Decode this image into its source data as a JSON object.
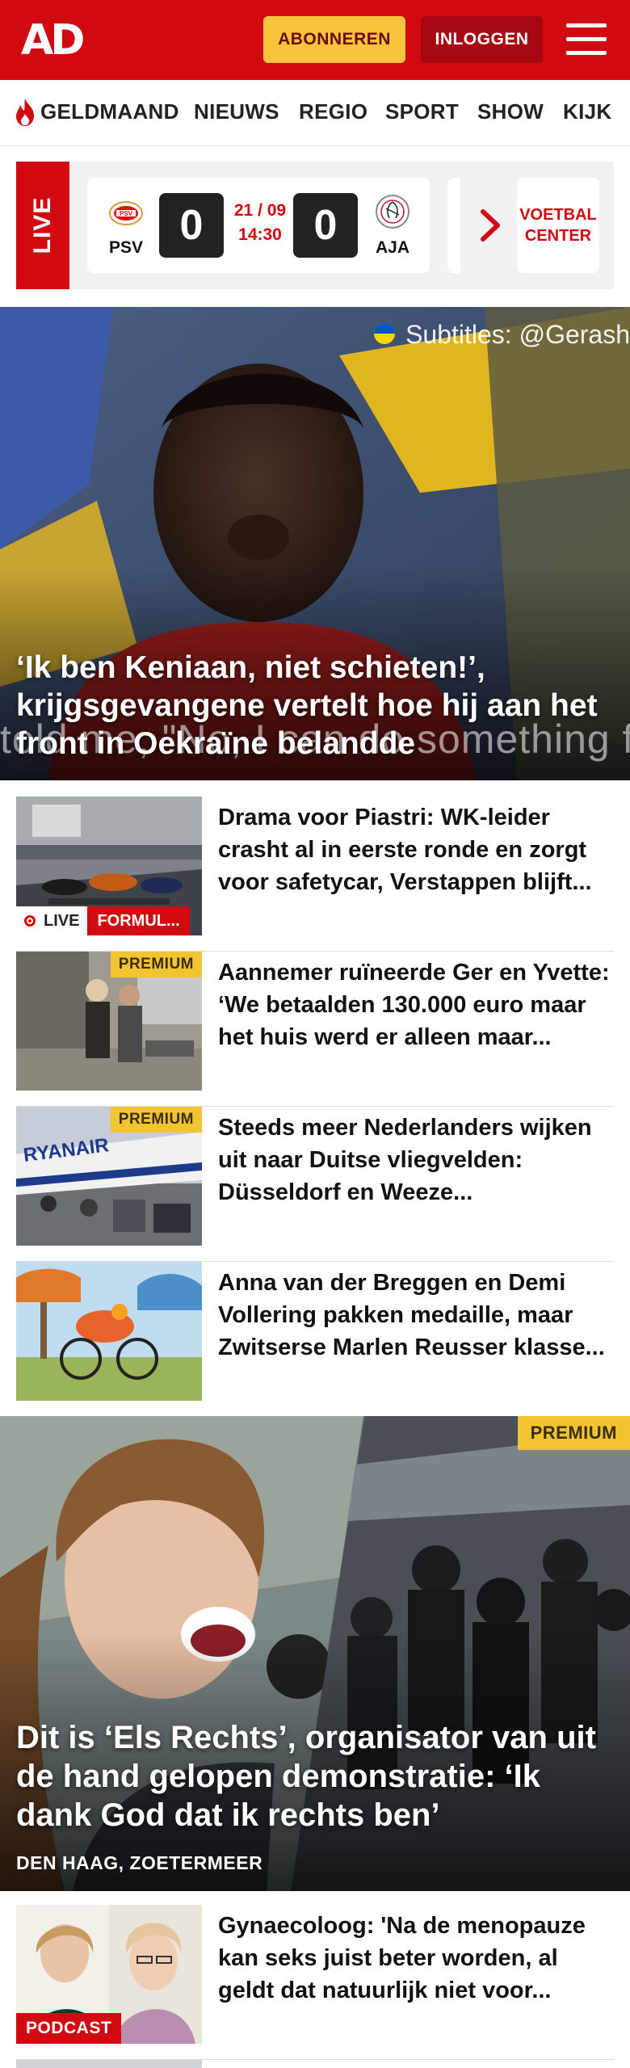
{
  "header": {
    "logo": "AD",
    "subscribe_label": "ABONNEREN",
    "login_label": "INLOGGEN",
    "menu_icon": "hamburger-icon",
    "brand_color": "#d10a11"
  },
  "nav": {
    "items": [
      {
        "label": "GELDMAAND",
        "icon": "flame-icon"
      },
      {
        "label": "NIEUWS"
      },
      {
        "label": "REGIO"
      },
      {
        "label": "SPORT"
      },
      {
        "label": "SHOW"
      },
      {
        "label": "KIJK"
      }
    ]
  },
  "live": {
    "tag": "LIVE",
    "match": {
      "home": {
        "name": "PSV",
        "score": "0"
      },
      "away": {
        "name": "AJA",
        "score": "0"
      },
      "date": "21 / 09",
      "time": "14:30"
    },
    "center_label_1": "VOETBAL",
    "center_label_2": "CENTER"
  },
  "hero": {
    "title": "‘Ik ben Keniaan, niet schieten!’, krijgsgevangene vertelt hoe hij aan het front in Oekraïne belandde",
    "subtitle_overlay": "Subtitles: @Gerash",
    "caption_overlay": "told me, \"No, I can do something fo"
  },
  "articles": [
    {
      "title": "Drama voor Piastri: WK-leider crasht al in eerste ronde en zorgt voor safetycar, Verstappen blijft...",
      "live_label": "LIVE",
      "category": "FORMUL..."
    },
    {
      "title": "Aannemer ruïneerde Ger en Yvette: ‘We betaalden 130.000 euro maar het huis werd er alleen maar...",
      "premium": "PREMIUM"
    },
    {
      "title": "Steeds meer Nederlanders wijken uit naar Duitse vliegvelden: Düsseldorf en Weeze...",
      "premium": "PREMIUM"
    },
    {
      "title": "Anna van der Breggen en Demi Vollering pakken medaille, maar Zwitserse Marlen Reusser klasse..."
    }
  ],
  "feature": {
    "premium": "PREMIUM",
    "title": "Dit is ‘Els Rechts’, organisator van uit de hand gelopen demonstratie: ‘Ik dank God dat ik rechts ben’",
    "location": "DEN HAAG, ZOETERMEER"
  },
  "podcast_article": {
    "title": "Gynaecoloog: 'Na de menopauze kan seks juist beter worden, al geldt dat natuurlijk niet voor...",
    "tag": "PODCAST"
  }
}
